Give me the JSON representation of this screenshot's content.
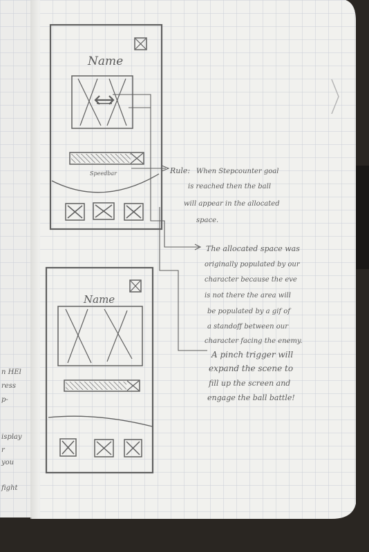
{
  "sketch_top": {
    "title": "Name",
    "bar_label": "Speedbar",
    "note_label": "Rule:",
    "note_lines": [
      "When Stepcounter goal",
      "is reached then the ball",
      "will appear in the allocated",
      "space."
    ],
    "note2_lines": [
      "The allocated space was",
      "originally populated by our",
      "character because the eve",
      "is not there the area will",
      "be populated by a gif of",
      "a standoff between our",
      "character facing the enemy."
    ]
  },
  "sketch_bottom": {
    "title": "Name",
    "note_lines": [
      "A pinch trigger will",
      "expand the scene to",
      "fill up the screen and",
      "engage the ball battle!"
    ]
  },
  "left_page_fragments": [
    "n HEl",
    "ress",
    "p-",
    "isplay",
    "r",
    "you",
    "fight"
  ],
  "colors": {
    "paper": "#f1f1ee",
    "grid": "#c9cdd6",
    "pencil": "#5f5f5f",
    "shadow": "#2a2622"
  }
}
